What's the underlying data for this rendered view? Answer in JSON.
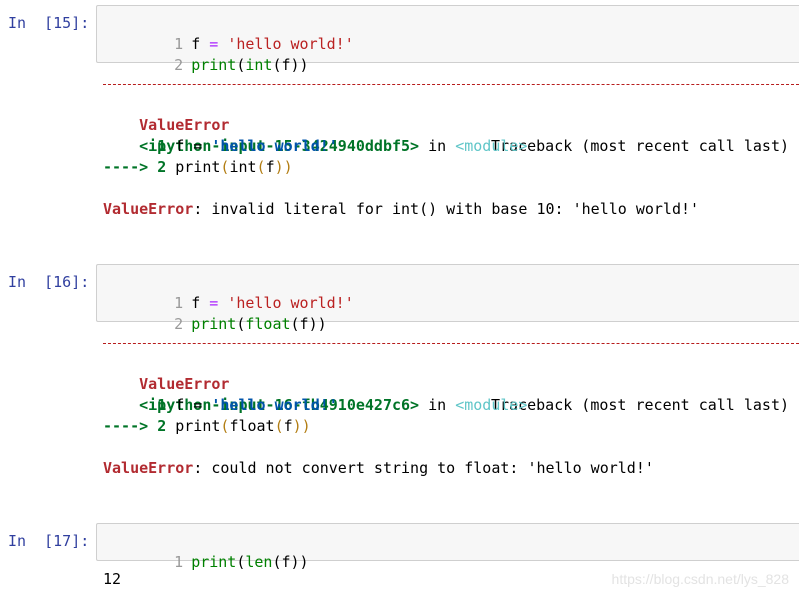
{
  "cells": [
    {
      "prompt": "In  [15]:",
      "lines": [
        {
          "num": "1",
          "text": "f = 'hello world!'"
        },
        {
          "num": "2",
          "text": "print(int(f))"
        }
      ],
      "traceback": {
        "error_name": "ValueError",
        "header_right": "Traceback (most recent call last)",
        "input_ref": "<ipython-input-15-3424940ddbf5>",
        "in_word": "in",
        "module": "<module>",
        "frame_line1_num": "1",
        "frame_line1_code": "f = 'hello world!'",
        "arrow": "---->",
        "frame_line2_num": "2",
        "frame_line2_code": "print(int(f))",
        "message_label": "ValueError",
        "message_text": ": invalid literal for int() with base 10: 'hello world!'"
      }
    },
    {
      "prompt": "In  [16]:",
      "lines": [
        {
          "num": "1",
          "text": "f = 'hello world!'"
        },
        {
          "num": "2",
          "text": "print(float(f))"
        }
      ],
      "traceback": {
        "error_name": "ValueError",
        "header_right": "Traceback (most recent call last)",
        "input_ref": "<ipython-input-16-fb4910e427c6>",
        "in_word": "in",
        "module": "<module>",
        "frame_line1_num": "1",
        "frame_line1_code": "f = 'hello world!'",
        "arrow": "---->",
        "frame_line2_num": "2",
        "frame_line2_code": "print(float(f))",
        "message_label": "ValueError",
        "message_text": ": could not convert string to float: 'hello world!'"
      }
    },
    {
      "prompt": "In  [17]:",
      "lines": [
        {
          "num": "1",
          "text": "print(len(f))"
        }
      ],
      "output": "12"
    }
  ],
  "watermark": "https://blog.csdn.net/lys_828"
}
